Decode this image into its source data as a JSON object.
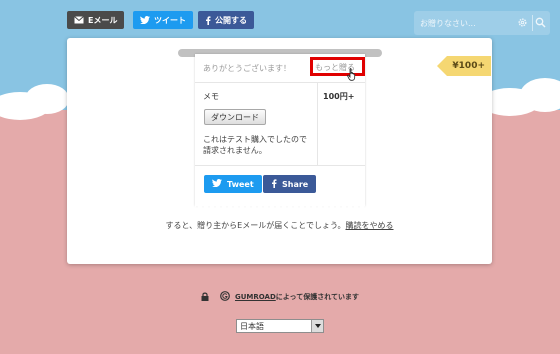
{
  "topbar": {
    "email_label": "Eメール",
    "tweet_label": "ツイート",
    "share_label": "公開する",
    "search_placeholder": "お贈りなさい..."
  },
  "price_tag": "¥100+",
  "receipt": {
    "thanks": "ありがとうございます！",
    "more_link": "もっと贈る",
    "item_name": "メモ",
    "item_price": "100円+",
    "download_label": "ダウンロード",
    "note": "これはテスト購入でしたので請求されません。",
    "tweet_label": "Tweet",
    "share_label": "Share"
  },
  "subtext": {
    "before": "すると、贈り主からEメールが届くことでしょう。",
    "link": "購読をやめる"
  },
  "footer": {
    "secure_brand": "GUMROAD",
    "secure_text": "によって保護されています",
    "language": "日本語"
  },
  "colors": {
    "twitter": "#1d9bf0",
    "facebook": "#3b5998",
    "email": "#4a4a4a",
    "sky": "#89c4e3",
    "ground": "#e4aaaa",
    "tag": "#f5d772",
    "highlight": "#e00000"
  }
}
